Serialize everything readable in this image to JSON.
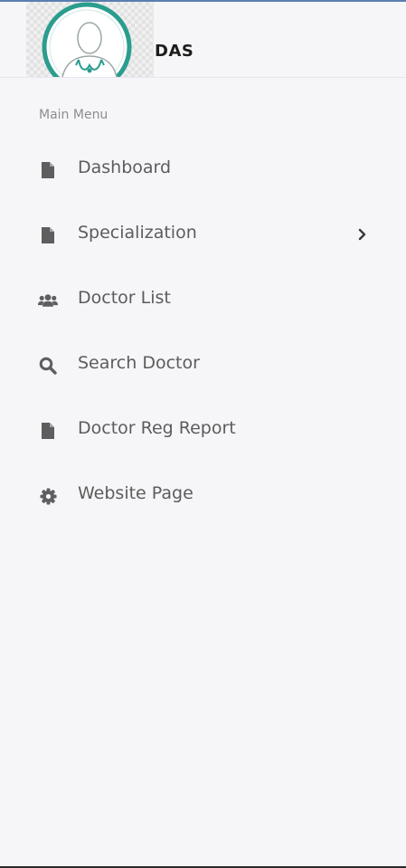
{
  "header": {
    "brand": "DAS",
    "logo_icon": "doctor-avatar-logo"
  },
  "sidebar": {
    "heading": "Main Menu",
    "items": [
      {
        "label": "Dashboard",
        "icon": "file-icon",
        "has_submenu": false
      },
      {
        "label": "Specialization",
        "icon": "file-icon",
        "has_submenu": true
      },
      {
        "label": "Doctor List",
        "icon": "users-icon",
        "has_submenu": false
      },
      {
        "label": "Search Doctor",
        "icon": "search-icon",
        "has_submenu": false
      },
      {
        "label": "Doctor Reg Report",
        "icon": "file-icon",
        "has_submenu": false
      },
      {
        "label": "Website Page",
        "icon": "gear-icon",
        "has_submenu": false
      }
    ]
  },
  "colors": {
    "background": "#f6f6f9",
    "text": "#5c5c5c",
    "icon": "#5e5e5e",
    "logo_ring": "#2a9d8f"
  }
}
